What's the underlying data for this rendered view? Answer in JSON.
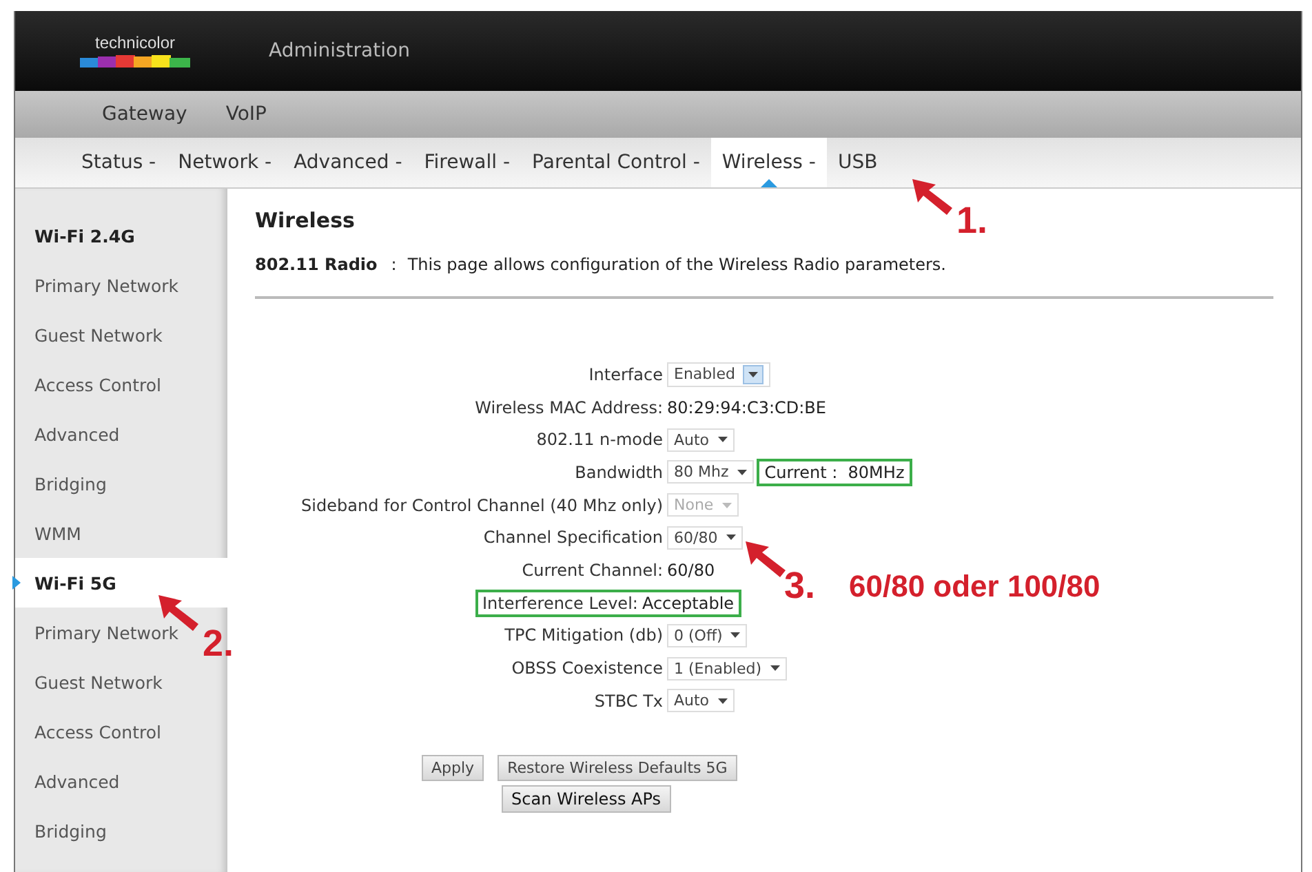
{
  "header": {
    "logo": "technicolor",
    "title": "Administration"
  },
  "main_nav": [
    {
      "label": "Gateway",
      "selected": false
    },
    {
      "label": "VoIP",
      "selected": false
    }
  ],
  "sub_nav": [
    {
      "label": "Status -",
      "selected": false
    },
    {
      "label": "Network -",
      "selected": false
    },
    {
      "label": "Advanced -",
      "selected": false
    },
    {
      "label": "Firewall -",
      "selected": false
    },
    {
      "label": "Parental Control -",
      "selected": false
    },
    {
      "label": "Wireless -",
      "selected": true
    },
    {
      "label": "USB",
      "selected": false
    }
  ],
  "sidebar": {
    "items": [
      {
        "label": "Wi-Fi 2.4G",
        "kind": "heading",
        "selected": false
      },
      {
        "label": "Primary Network",
        "kind": "link",
        "selected": false
      },
      {
        "label": "Guest Network",
        "kind": "link",
        "selected": false
      },
      {
        "label": "Access Control",
        "kind": "link",
        "selected": false
      },
      {
        "label": "Advanced",
        "kind": "link",
        "selected": false
      },
      {
        "label": "Bridging",
        "kind": "link",
        "selected": false
      },
      {
        "label": "WMM",
        "kind": "link",
        "selected": false
      },
      {
        "label": "Wi-Fi 5G",
        "kind": "heading",
        "selected": true
      },
      {
        "label": "Primary Network",
        "kind": "link",
        "selected": false
      },
      {
        "label": "Guest Network",
        "kind": "link",
        "selected": false
      },
      {
        "label": "Access Control",
        "kind": "link",
        "selected": false
      },
      {
        "label": "Advanced",
        "kind": "link",
        "selected": false
      },
      {
        "label": "Bridging",
        "kind": "link",
        "selected": false
      }
    ]
  },
  "content": {
    "title": "Wireless",
    "intro_label": "802.11 Radio",
    "intro_separator": ":",
    "intro_text": "This page allows configuration of the Wireless Radio parameters.",
    "fields": [
      {
        "label": "Interface",
        "kind": "select",
        "value": "Enabled",
        "disabled": false,
        "highlighted": false
      },
      {
        "label": "Wireless MAC Address:",
        "kind": "text",
        "value": "80:29:94:C3:CD:BE",
        "highlighted": false
      },
      {
        "label": "802.11 n-mode",
        "kind": "select",
        "value": "Auto",
        "disabled": false,
        "highlighted": false
      },
      {
        "label": "Bandwidth",
        "kind": "select",
        "value": "80 Mhz",
        "disabled": false,
        "highlighted": false,
        "note": "Current :  80MHz",
        "note_highlighted": true
      },
      {
        "label": "Sideband for Control Channel (40 Mhz only)",
        "kind": "select",
        "value": "None",
        "disabled": true,
        "highlighted": false
      },
      {
        "label": "Channel Specification",
        "kind": "select",
        "value": "60/80",
        "disabled": false,
        "highlighted": false
      },
      {
        "label": "Current Channel:",
        "kind": "text",
        "value": "60/80",
        "highlighted": false
      },
      {
        "label": "Interference Level:",
        "kind": "text",
        "value": "Acceptable",
        "highlighted": true
      },
      {
        "label": "TPC Mitigation (db)",
        "kind": "select",
        "value": "0 (Off)",
        "disabled": false,
        "highlighted": false
      },
      {
        "label": "OBSS Coexistence",
        "kind": "select",
        "value": "1 (Enabled)",
        "disabled": false,
        "highlighted": false
      },
      {
        "label": "STBC Tx",
        "kind": "select",
        "value": "Auto",
        "disabled": false,
        "highlighted": false
      }
    ],
    "buttons": [
      {
        "label": "Apply",
        "kind": "secondary"
      },
      {
        "label": "Restore Wireless Defaults 5G",
        "kind": "secondary"
      },
      {
        "label": "Scan Wireless APs",
        "kind": "primary"
      }
    ]
  },
  "annotations": [
    {
      "kind": "step",
      "label": "1."
    },
    {
      "kind": "step",
      "label": "2."
    },
    {
      "kind": "step",
      "label": "3."
    },
    {
      "kind": "note",
      "label": "60/80 oder 100/80"
    }
  ]
}
